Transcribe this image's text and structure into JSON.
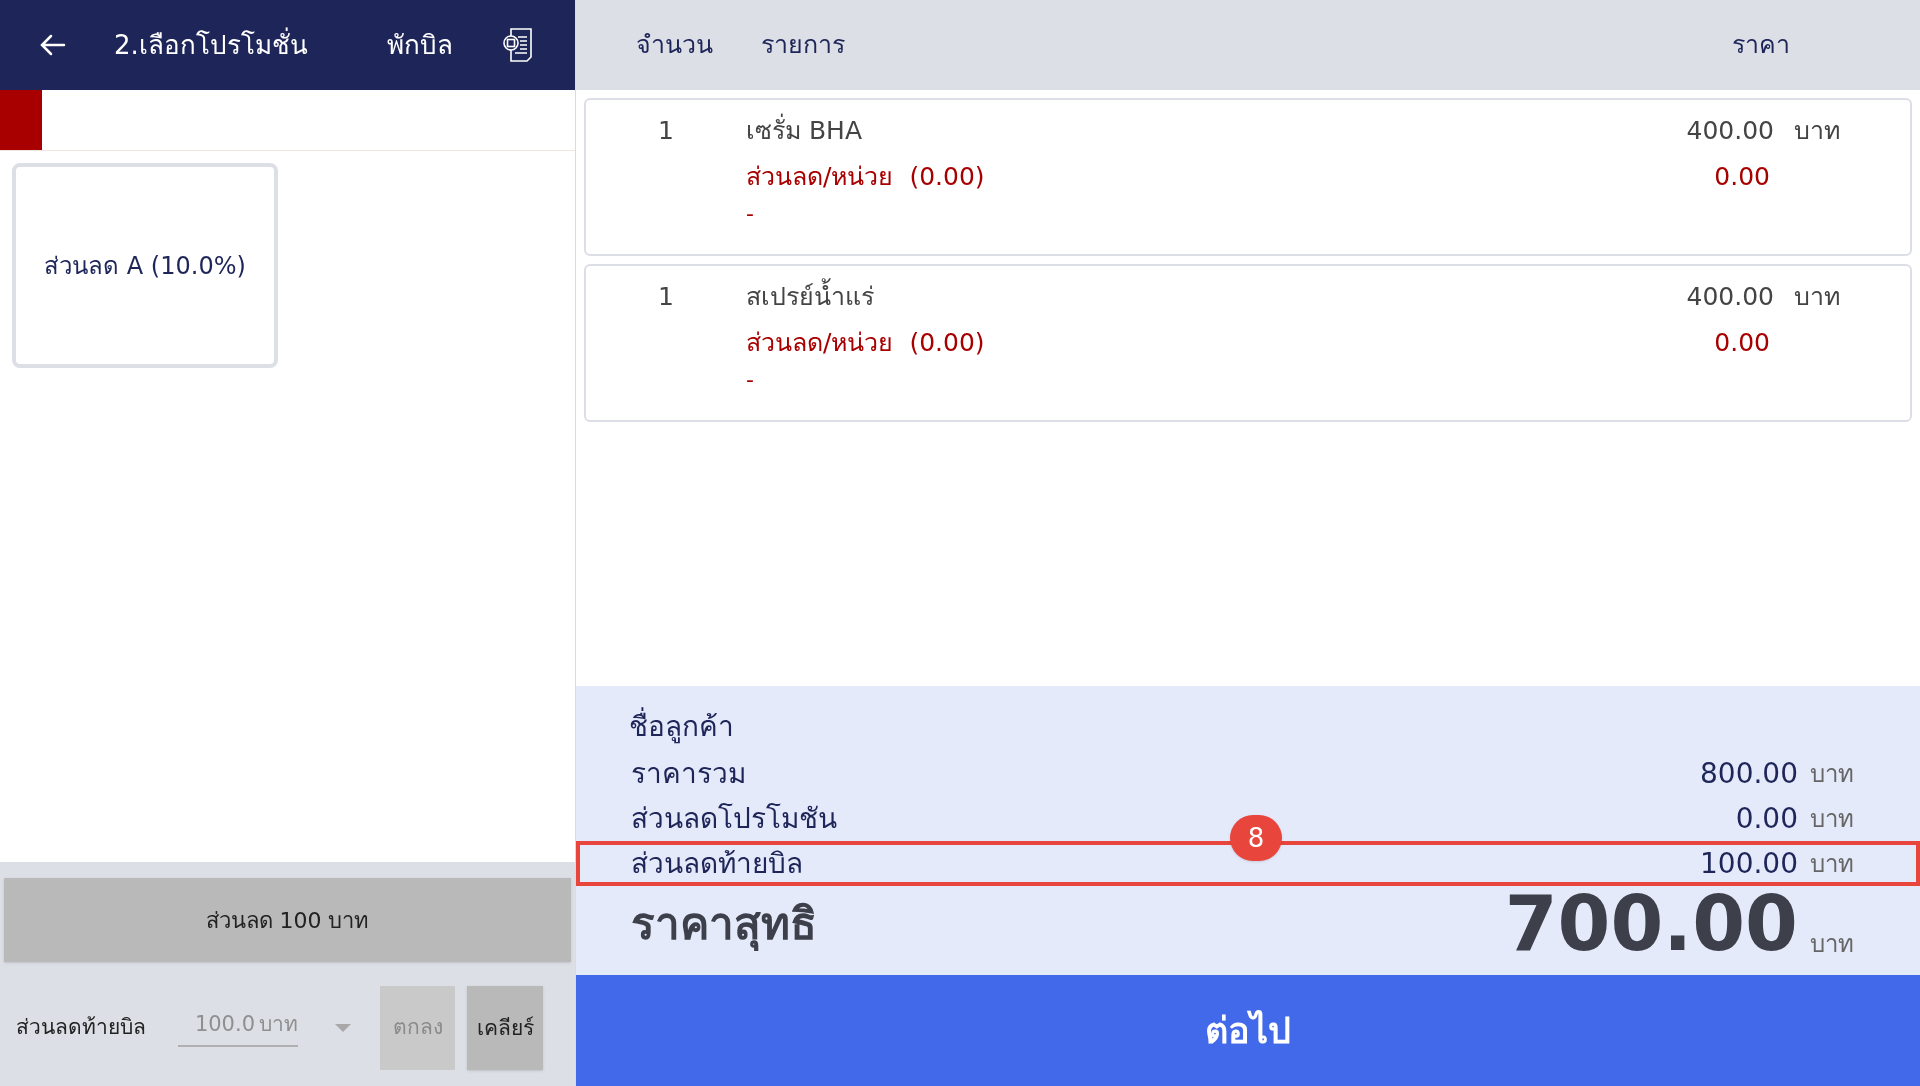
{
  "header": {
    "title": "2.เลือกโปรโมชั่น",
    "hold_bill": "พักบิล"
  },
  "promotions": [
    {
      "label": "ส่วนลด A (10.0%)",
      "selected": false
    }
  ],
  "discount_button": "ส่วนลด 100 บาท",
  "bill_discount": {
    "label": "ส่วนลดท้ายบิล",
    "value": "100.0",
    "unit": "บาท"
  },
  "ok_button": {
    "label": "ตกลง",
    "disabled": true
  },
  "clear_button": {
    "label": "เคลียร์",
    "disabled": false
  },
  "table": {
    "columns": [
      "จำนวน",
      "รายการ",
      "ราคา"
    ],
    "rows": [
      {
        "qty": "1",
        "name": "เซรั่ม BHA",
        "price": "400.00",
        "unit": "บาท",
        "discount_label": "ส่วนลด/หน่วย",
        "discount_value": "(0.00)",
        "discount_amount": "0.00",
        "note": "-"
      },
      {
        "qty": "1",
        "name": "สเปรย์น้ำแร่",
        "price": "400.00",
        "unit": "บาท",
        "discount_label": "ส่วนลด/หน่วย",
        "discount_value": "(0.00)",
        "discount_amount": "0.00",
        "note": "-"
      }
    ]
  },
  "summary": {
    "customer_label": "ชื่อลูกค้า",
    "lines": [
      {
        "label": "ราคารวม",
        "value": "800.00",
        "unit": "บาท",
        "highlighted": false
      },
      {
        "label": "ส่วนลดโปรโมชัน",
        "value": "0.00",
        "unit": "บาท",
        "highlighted": false
      },
      {
        "label": "ส่วนลดท้ายบิล",
        "value": "100.00",
        "unit": "บาท",
        "highlighted": true,
        "callout": "8"
      }
    ],
    "net": {
      "label": "ราคาสุทธิ",
      "value": "700.00",
      "unit": "บาท"
    }
  },
  "next_button": "ต่อไป"
}
